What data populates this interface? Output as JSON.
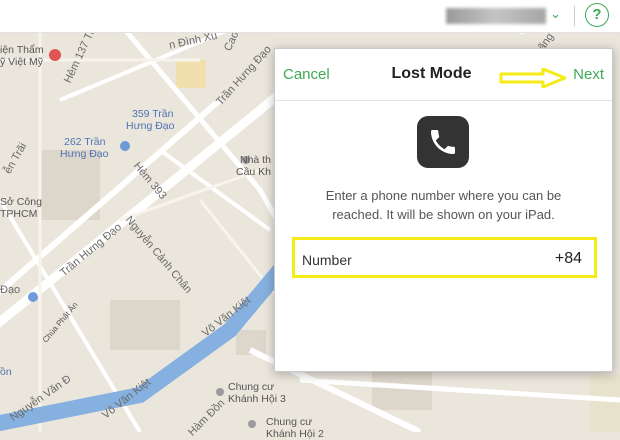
{
  "topbar": {
    "help_glyph": "?",
    "chevron_glyph": "⌄"
  },
  "dialog": {
    "cancel_label": "Cancel",
    "title": "Lost Mode",
    "next_label": "Next",
    "message_line1": "Enter a phone number where you can be",
    "message_line2": "reached. It will be shown on your iPad.",
    "number_label": "Number",
    "number_value": "+84"
  },
  "map": {
    "labels": {
      "l1": "iện Thẩm",
      "l2": "ỹ Việt Mỹ",
      "l3": "Hẻm 137 Trần Đ",
      "l4": "ễn Trãi",
      "l5": "262 Trần",
      "l6": "Hưng Đạo",
      "l7": "359 Trần",
      "l8": "Hưng Đạo",
      "l9": "Sở Công",
      "l10": "TPHCM",
      "l11": "Trần Hưng Đạo",
      "l12": "Hẻm 393",
      "l13": "Nguyễn Cảnh Chân",
      "l14": "Võ Văn Kiệt",
      "l15": "Võ Văn Kiệt",
      "l16": "Chùa Phật Ân",
      "l17": "ồn",
      "l18": "Nguyễn Văn Đ",
      "l19": "Chung cư",
      "l20": "Khánh Hội 3",
      "l21": "Chung cư",
      "l22": "Khánh Hội 2",
      "l23": "Nhà th",
      "l24": "Cầu Kh",
      "l25": "n Đình Xủ",
      "l26": "Cao",
      "l27": "Trần Hưng Đạo",
      "l28": "Hàm Đồn",
      "l29": "ãng Đạo",
      "l30": "Đạo"
    }
  },
  "colors": {
    "accent": "#3faa55",
    "highlight": "#f5eb17",
    "map_bg": "#ebe6dc",
    "water": "#86b0e0"
  }
}
